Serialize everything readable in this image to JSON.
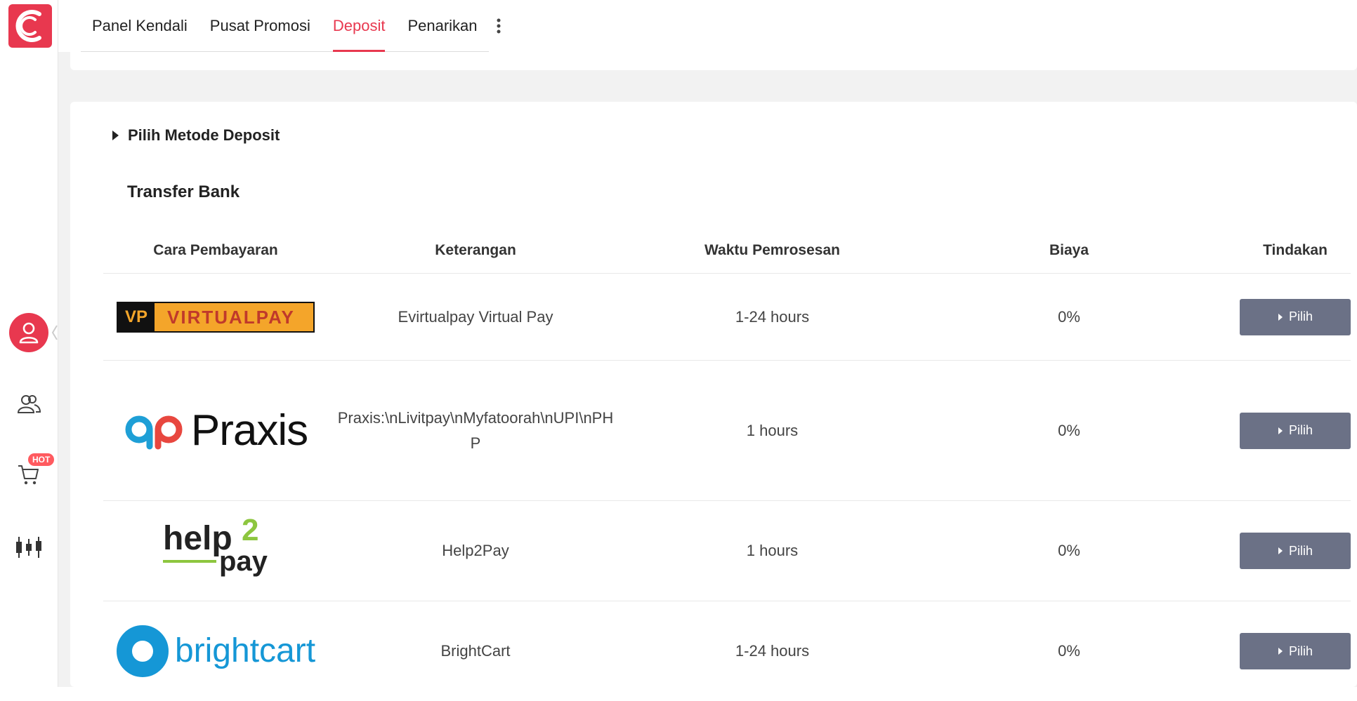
{
  "nav": {
    "tabs": [
      {
        "label": "Panel Kendali"
      },
      {
        "label": "Pusat Promosi"
      },
      {
        "label": "Deposit"
      },
      {
        "label": "Penarikan"
      }
    ],
    "active_tab": "Deposit",
    "accent_color": "#e8384f"
  },
  "sidebar": {
    "badge": "HOT"
  },
  "deposit": {
    "section_title": "Pilih Metode Deposit",
    "group_title": "Transfer Bank",
    "columns": [
      "Cara Pembayaran",
      "Keterangan",
      "Waktu Pemrosesan",
      "Biaya",
      "Tindakan"
    ],
    "rows": [
      {
        "logo_text": "VP",
        "logo_name": "VIRTUALPAY",
        "description": "Evirtualpay Virtual Pay",
        "time": "1-24 hours",
        "fee": "0%",
        "action": "Pilih"
      },
      {
        "logo_text": "Praxis",
        "description": "Praxis:\\nLivitpay\\nMyfatoorah\\nUPI\\nPHP",
        "time": "1 hours",
        "fee": "0%",
        "action": "Pilih"
      },
      {
        "logo_text": "help",
        "logo_sub": "2",
        "logo_sub2": "pay",
        "description": "Help2Pay",
        "time": "1 hours",
        "fee": "0%",
        "action": "Pilih"
      },
      {
        "logo_text": "brightcart",
        "description": "BrightCart",
        "time": "1-24 hours",
        "fee": "0%",
        "action": "Pilih"
      }
    ],
    "button_color": "#6b7186"
  }
}
